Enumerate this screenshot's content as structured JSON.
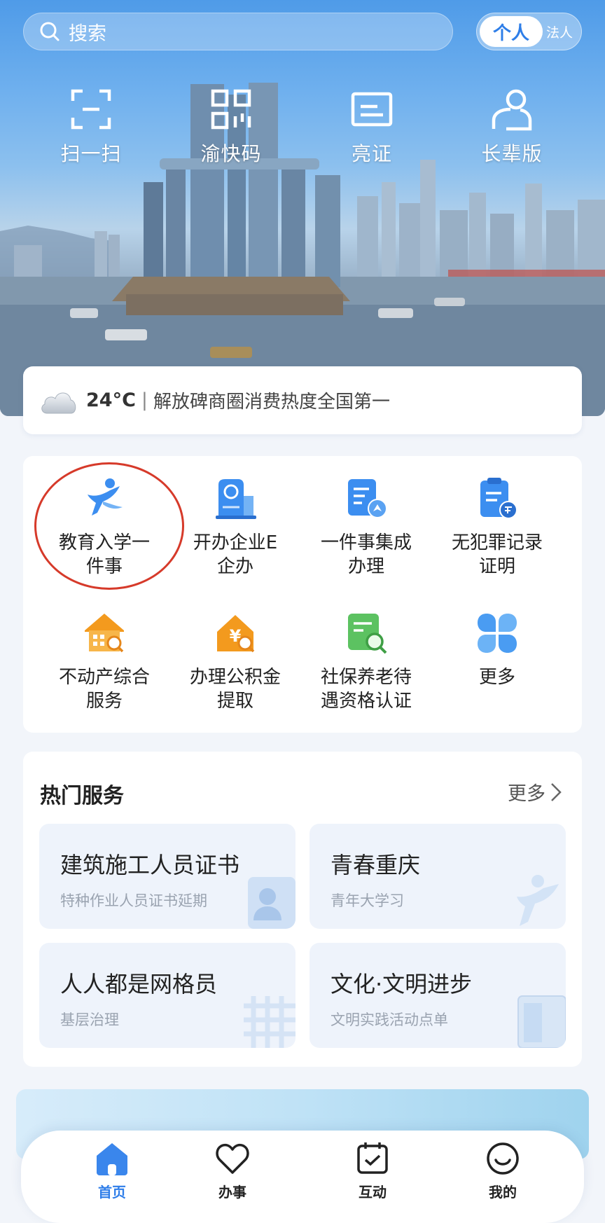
{
  "search": {
    "placeholder": "搜索"
  },
  "identity_toggle": {
    "active": "个人",
    "inactive": "法人"
  },
  "quick_actions": [
    {
      "label": "扫一扫",
      "icon": "scan-icon"
    },
    {
      "label": "渝快码",
      "icon": "qrcode-icon"
    },
    {
      "label": "亮证",
      "icon": "id-card-icon"
    },
    {
      "label": "长辈版",
      "icon": "elder-mode-icon"
    }
  ],
  "weather": {
    "temperature": "24°C",
    "separator": "|",
    "headline": "解放碑商圈消费热度全国第一",
    "icon": "cloud-icon"
  },
  "services": [
    {
      "line1": "教育入学一",
      "line2": "件事",
      "icon": "education-icon"
    },
    {
      "line1": "开办企业E",
      "line2": "企办",
      "icon": "enterprise-icon"
    },
    {
      "line1": "一件事集成",
      "line2": "办理",
      "icon": "integrated-service-icon"
    },
    {
      "line1": "无犯罪记录",
      "line2": "证明",
      "icon": "no-criminal-record-icon"
    },
    {
      "line1": "不动产综合",
      "line2": "服务",
      "icon": "real-estate-icon"
    },
    {
      "line1": "办理公积金",
      "line2": "提取",
      "icon": "housing-fund-icon"
    },
    {
      "line1": "社保养老待",
      "line2": "遇资格认证",
      "icon": "social-security-icon"
    },
    {
      "line1": "更多",
      "line2": "",
      "icon": "more-grid-icon"
    }
  ],
  "hot_services": {
    "title": "热门服务",
    "more": "更多",
    "items": [
      {
        "title": "建筑施工人员证书",
        "subtitle": "特种作业人员证书延期"
      },
      {
        "title": "青春重庆",
        "subtitle": "青年大学习"
      },
      {
        "title": "人人都是网格员",
        "subtitle": "基层治理"
      },
      {
        "title": "文化·文明进步",
        "subtitle": "文明实践活动点单"
      }
    ]
  },
  "bottom_nav": [
    {
      "label": "首页",
      "icon": "home-icon",
      "active": true
    },
    {
      "label": "办事",
      "icon": "heart-icon",
      "active": false
    },
    {
      "label": "互动",
      "icon": "calendar-check-icon",
      "active": false
    },
    {
      "label": "我的",
      "icon": "smile-icon",
      "active": false
    }
  ],
  "colors": {
    "accent": "#2f7ee9",
    "highlight_circle": "#d63a2a",
    "icon_blue": "#3c8ef0",
    "icon_orange": "#f39a1e",
    "icon_green": "#5cc261"
  }
}
